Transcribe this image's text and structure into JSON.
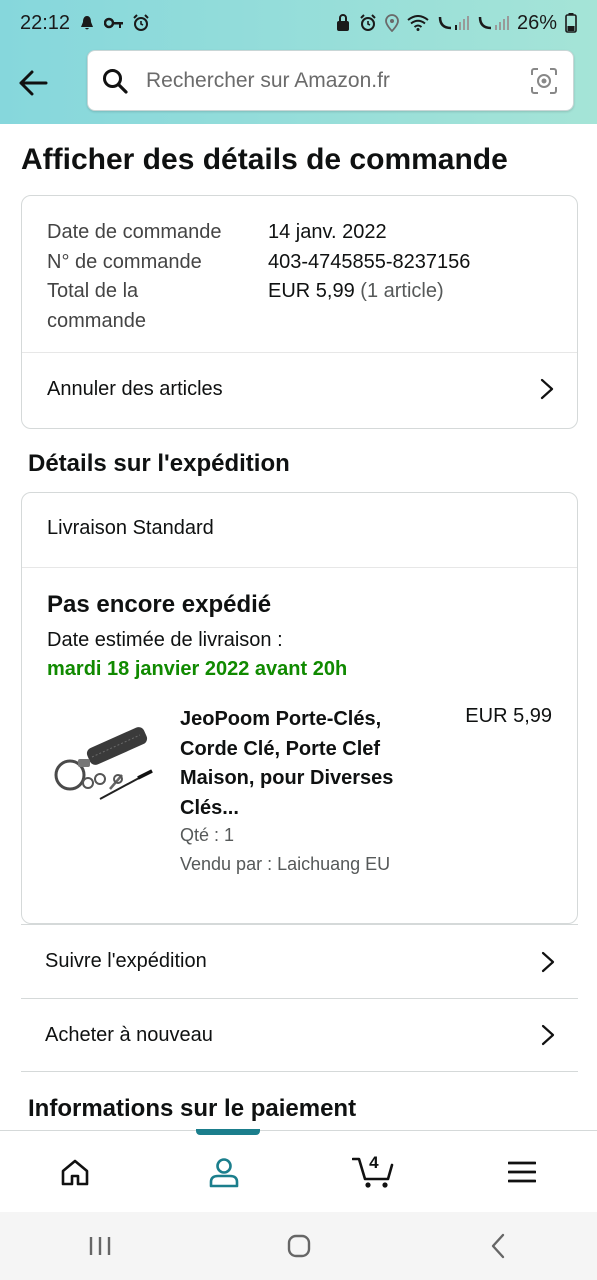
{
  "status_bar": {
    "time": "22:12",
    "battery": "26%",
    "icons_left": [
      "notification-icon",
      "key-icon",
      "alarm-icon"
    ],
    "icons_right": [
      "lock-icon",
      "alarm-icon",
      "location-icon",
      "wifi-icon",
      "volte-signal-icon",
      "volte-signal-2-icon",
      "battery-icon"
    ]
  },
  "header": {
    "search_placeholder": "Rechercher sur Amazon.fr"
  },
  "page": {
    "title": "Afficher des détails de commande"
  },
  "order_summary": {
    "rows": [
      {
        "label": "Date de commande",
        "value": "14 janv. 2022"
      },
      {
        "label": "N° de commande",
        "value": "403-4745855-8237156"
      },
      {
        "label": "Total de la commande",
        "value": "EUR 5,99",
        "extra": "(1 article)"
      }
    ],
    "cancel_label": "Annuler des articles"
  },
  "shipment": {
    "section_title": "Détails sur l'expédition",
    "method": "Livraison Standard",
    "status": "Pas encore expédié",
    "estimate_label": "Date estimée de livraison :",
    "estimate_date": "mardi 18 janvier 2022 avant 20h",
    "product": {
      "title_lines": [
        "JeoPoom Porte-Clés,",
        "Corde Clé, Porte Clef",
        "Maison, pour Diverses",
        "Clés..."
      ],
      "price": "EUR 5,99",
      "qty": "Qté : 1",
      "seller": "Vendu par : Laichuang EU"
    }
  },
  "actions": {
    "track": "Suivre l'expédition",
    "buy_again": "Acheter à nouveau"
  },
  "payment": {
    "section_title": "Informations sur le paiement"
  },
  "bottom_nav": {
    "items": [
      "home-icon",
      "account-icon",
      "cart-icon",
      "menu-icon"
    ],
    "active": "account-icon",
    "cart_count": "4"
  },
  "colors": {
    "header_gradient_start": "#86d7dc",
    "header_gradient_end": "#a5e4d7",
    "accent": "#1b7e8c",
    "delivery_green": "#108a00"
  }
}
